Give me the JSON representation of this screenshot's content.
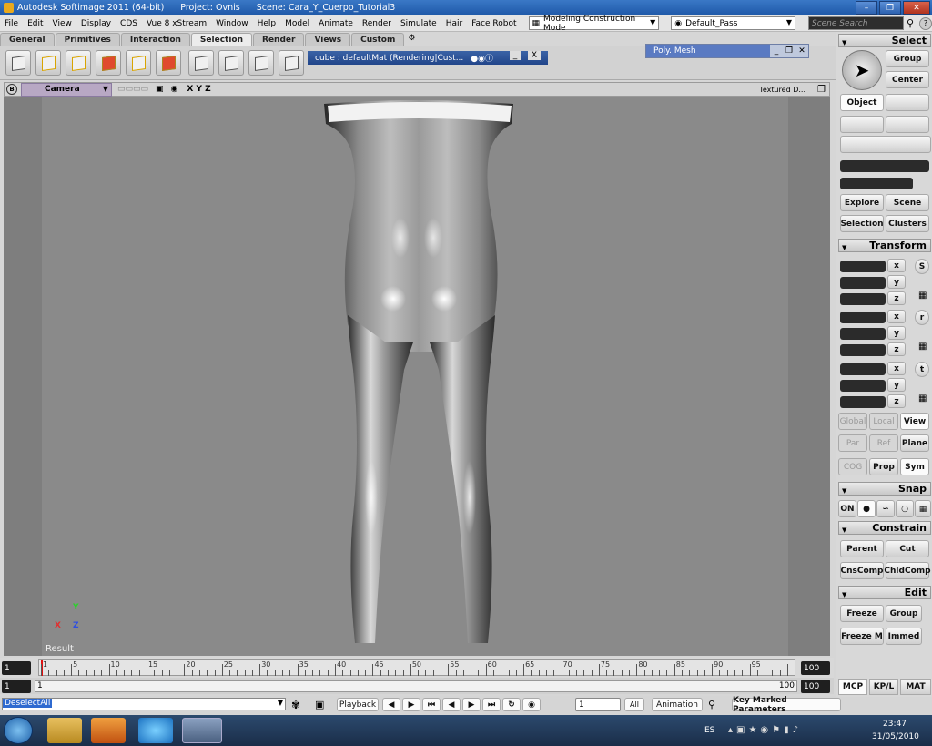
{
  "titlebar": {
    "app": "Autodesk Softimage 2011 (64-bit)",
    "project": "Project: Ovnis",
    "scene": "Scene: Cara_Y_Cuerpo_Tutorial3"
  },
  "menu": [
    "File",
    "Edit",
    "View",
    "Display",
    "CDS",
    "Vue 8 xStream",
    "Window",
    "Help",
    "Model",
    "Animate",
    "Render",
    "Simulate",
    "Hair",
    "Face Robot"
  ],
  "mode_dropdown": "Modeling Construction Mode",
  "pass_dropdown": "Default_Pass",
  "scene_search_placeholder": "Scene Search",
  "tabs": [
    "General",
    "Primitives",
    "Interaction",
    "Selection",
    "Render",
    "Views",
    "Custom"
  ],
  "material_bar": "cube : defaultMat (Rendering|Cust...",
  "material_close": "X",
  "poly_mesh": "Poly. Mesh",
  "viewport": {
    "badge": "B",
    "camera": "Camera",
    "xyz": "X Y Z",
    "display_mode": "Textured D...",
    "result_label": "Result",
    "axis_y": "Y",
    "axis_x": "X",
    "axis_z": "Z"
  },
  "timeline": {
    "start": "1",
    "end": "100",
    "ticks": [
      "1",
      "5",
      "10",
      "15",
      "20",
      "25",
      "30",
      "35",
      "40",
      "45",
      "50",
      "55",
      "60",
      "65",
      "70",
      "75",
      "80",
      "85",
      "90",
      "95"
    ],
    "range_start": "1",
    "range_inner": "1",
    "range_inner_end": "100",
    "range_end": "100"
  },
  "cmdbar": {
    "command": "DeselectAll",
    "playback": "Playback",
    "frame": "1",
    "all": "All",
    "animation": "Animation",
    "key_marked": "Key Marked Parameters"
  },
  "panel": {
    "select": "Select",
    "group": "Group",
    "center": "Center",
    "object": "Object",
    "explore": "Explore",
    "scene": "Scene",
    "selection": "Selection",
    "clusters": "Clusters",
    "transform": "Transform",
    "x": "x",
    "y": "y",
    "z": "z",
    "s": "S",
    "r": "r",
    "t": "t",
    "global": "Global",
    "local": "Local",
    "view": "View",
    "par": "Par",
    "ref": "Ref",
    "plane": "Plane",
    "cog": "COG",
    "prop": "Prop",
    "sym": "Sym",
    "snap": "Snap",
    "on": "ON",
    "constrain": "Constrain",
    "parent": "Parent",
    "cut": "Cut",
    "cnscomp": "CnsComp",
    "chldcomp": "ChldComp",
    "edit": "Edit",
    "freeze": "Freeze",
    "edit_group": "Group",
    "freeze_m": "Freeze M",
    "immed": "Immed",
    "mcp": "MCP",
    "kpl": "KP/L",
    "mat": "MAT"
  },
  "taskbar": {
    "lang": "ES",
    "time": "23:47",
    "date": "31/05/2010"
  },
  "colors": {
    "title": "#1e58a8",
    "viewport": "#8a8a8a",
    "taskbar": "#1a2d48"
  }
}
